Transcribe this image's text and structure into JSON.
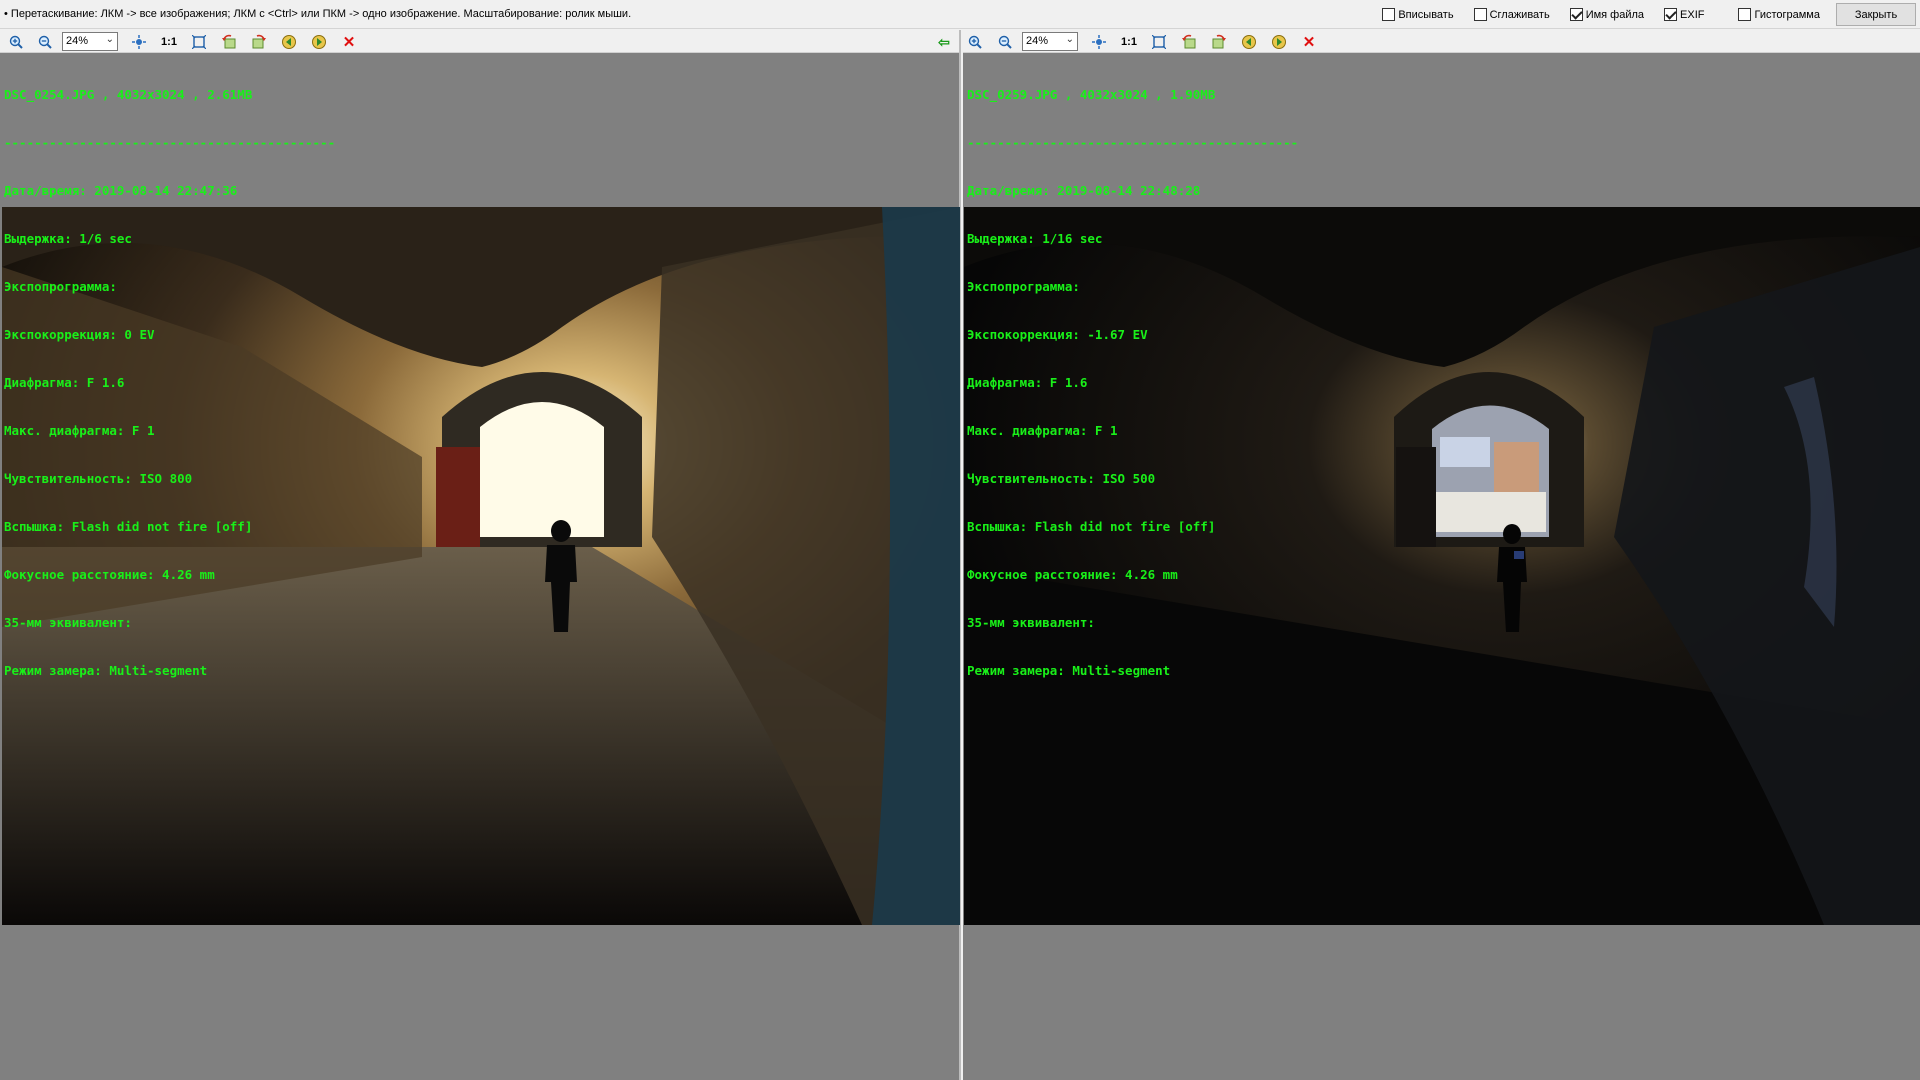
{
  "hint": "• Перетаскивание: ЛКМ -> все изображения; ЛКМ с <Ctrl> или ПКМ -> одно изображение. Масштабирование: ролик мыши.",
  "options": {
    "fit_label": "Вписывать",
    "fit_checked": false,
    "smooth_label": "Сглаживать",
    "smooth_checked": false,
    "filename_label": "Имя файла",
    "filename_checked": true,
    "exif_label": "EXIF",
    "exif_checked": true,
    "histogram_label": "Гистограмма",
    "histogram_checked": false
  },
  "close_label": "Закрыть",
  "left": {
    "zoom": "24%",
    "one_to_one": "1:1",
    "exif_lines": [
      "DSC_0254.JPG , 4032x3024 , 2.61MB",
      "--------------------------------------------",
      "Дата/время: 2019-08-14 22:47:36",
      "Выдержка: 1/6 sec",
      "Экспопрограмма:",
      "Экспокоррекция: 0 EV",
      "Диафрагма: F 1.6",
      "Макс. диафрагма: F 1",
      "Чувствительность: ISO 800",
      "Вспышка: Flash did not fire [off]",
      "Фокусное расстояние: 4.26 mm",
      "35-мм эквивалент:",
      "Режим замера: Multi-segment"
    ]
  },
  "right": {
    "zoom": "24%",
    "one_to_one": "1:1",
    "exif_lines": [
      "DSC_0259.JPG , 4032x3024 , 1.90MB",
      "--------------------------------------------",
      "Дата/время: 2019-08-14 22:48:28",
      "Выдержка: 1/16 sec",
      "Экспопрограмма:",
      "Экспокоррекция: -1.67 EV",
      "Диафрагма: F 1.6",
      "Макс. диафрагма: F 1",
      "Чувствительность: ISO 500",
      "Вспышка: Flash did not fire [off]",
      "Фокусное расстояние: 4.26 mm",
      "35-мм эквивалент:",
      "Режим замера: Multi-segment"
    ]
  }
}
